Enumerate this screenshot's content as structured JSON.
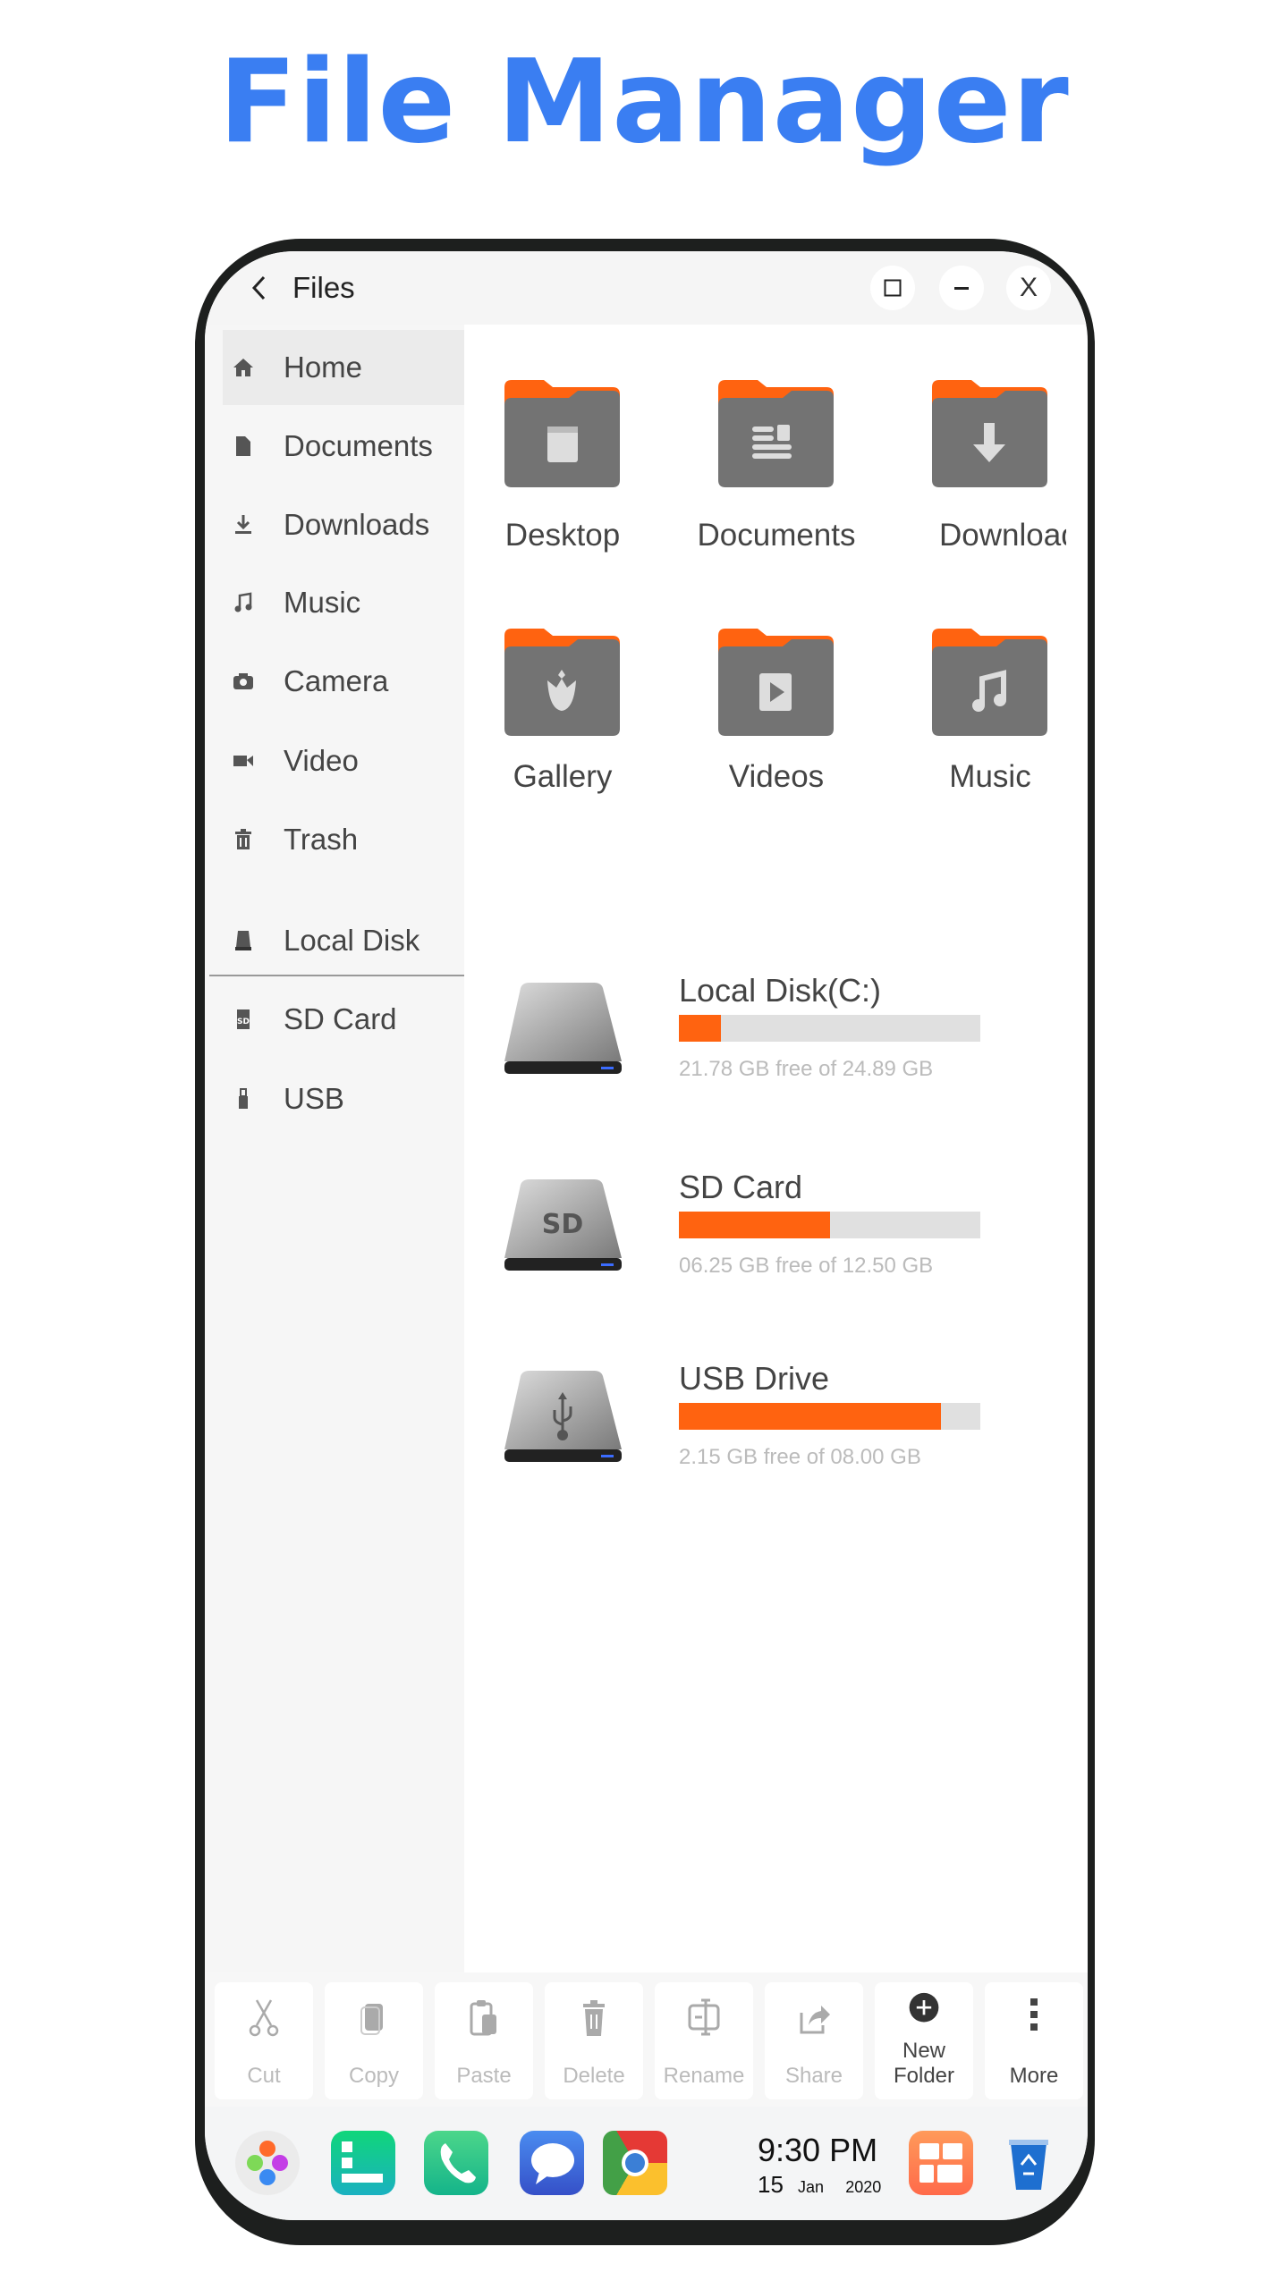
{
  "headline": "File Manager",
  "window": {
    "title": "Files",
    "controls": [
      "maximize",
      "minimize",
      "close"
    ],
    "close_glyph": "X"
  },
  "sidebar": {
    "items": [
      {
        "label": "Home",
        "icon": "home-icon",
        "active": true
      },
      {
        "label": "Documents",
        "icon": "document-icon"
      },
      {
        "label": "Downloads",
        "icon": "download-icon"
      },
      {
        "label": "Music",
        "icon": "music-icon"
      },
      {
        "label": "Camera",
        "icon": "camera-icon"
      },
      {
        "label": "Video",
        "icon": "video-icon"
      },
      {
        "label": "Trash",
        "icon": "trash-icon"
      }
    ],
    "devices": [
      {
        "label": "Local Disk",
        "icon": "disk-icon"
      },
      {
        "label": "SD Card",
        "icon": "sd-card-icon"
      },
      {
        "label": "USB",
        "icon": "usb-icon"
      }
    ]
  },
  "folders": [
    {
      "label": "Desktop",
      "icon": "window-icon"
    },
    {
      "label": "Documents",
      "icon": "article-icon"
    },
    {
      "label": "Downloads",
      "icon": "arrow-down-icon"
    },
    {
      "label": "Gallery",
      "icon": "tulip-icon"
    },
    {
      "label": "Videos",
      "icon": "film-play-icon"
    },
    {
      "label": "Music",
      "icon": "music-note-icon"
    }
  ],
  "drives": [
    {
      "name": "Local Disk(C:)",
      "info": "21.78 GB free of 24.89 GB",
      "used_percent": 14,
      "badge": ""
    },
    {
      "name": "SD Card",
      "info": "06.25 GB free of 12.50 GB",
      "used_percent": 50,
      "badge": "SD"
    },
    {
      "name": "USB Drive",
      "info": "2.15 GB free of 08.00 GB",
      "used_percent": 87,
      "badge": ""
    }
  ],
  "toolbar": [
    {
      "label": "Cut",
      "icon": "scissors-icon",
      "enabled": false
    },
    {
      "label": "Copy",
      "icon": "copy-icon",
      "enabled": false
    },
    {
      "label": "Paste",
      "icon": "paste-icon",
      "enabled": false
    },
    {
      "label": "Delete",
      "icon": "trash-icon",
      "enabled": false
    },
    {
      "label": "Rename",
      "icon": "rename-icon",
      "enabled": false
    },
    {
      "label": "Share",
      "icon": "share-icon",
      "enabled": false
    },
    {
      "label": "New Folder",
      "icon": "plus-circle-icon",
      "enabled": true
    },
    {
      "label": "More",
      "icon": "more-vertical-icon",
      "enabled": true
    }
  ],
  "dock": {
    "apps": [
      "launcher",
      "notes",
      "phone",
      "messages",
      "chrome",
      "widgets",
      "recycle-bin"
    ],
    "time": "9:30 PM",
    "day": "15",
    "month": "Jan",
    "year": "2020"
  },
  "colors": {
    "accent": "#ff6310",
    "headline": "#3a7ef2",
    "folder": "#737373",
    "bar_track": "#e0e0e0"
  }
}
